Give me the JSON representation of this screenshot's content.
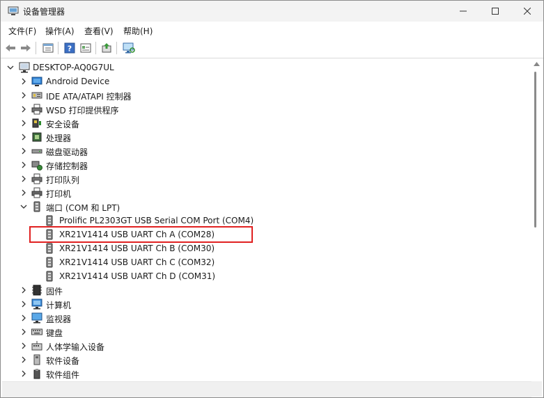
{
  "window": {
    "title": "设备管理器",
    "controls": [
      "minimize",
      "maximize",
      "close"
    ]
  },
  "menu": [
    "文件(F)",
    "操作(A)",
    "查看(V)",
    "帮助(H)"
  ],
  "toolbar": [
    "back-icon",
    "forward-icon",
    "properties-icon",
    "help-icon",
    "view-icon",
    "update-driver-icon",
    "monitor-scan-icon"
  ],
  "tree": {
    "root": "DESKTOP-AQ0G7UL",
    "categories": [
      {
        "label": "Android Device",
        "icon": "android-device-icon"
      },
      {
        "label": "IDE ATA/ATAPI 控制器",
        "icon": "ide-controller-icon"
      },
      {
        "label": "WSD 打印提供程序",
        "icon": "printer-provider-icon"
      },
      {
        "label": "安全设备",
        "icon": "security-device-icon"
      },
      {
        "label": "处理器",
        "icon": "processor-icon"
      },
      {
        "label": "磁盘驱动器",
        "icon": "disk-drive-icon"
      },
      {
        "label": "存储控制器",
        "icon": "storage-controller-icon"
      },
      {
        "label": "打印队列",
        "icon": "print-queue-icon"
      },
      {
        "label": "打印机",
        "icon": "printer-icon"
      },
      {
        "label": "端口 (COM 和 LPT)",
        "icon": "port-icon",
        "expanded": true
      },
      {
        "label": "固件",
        "icon": "firmware-icon"
      },
      {
        "label": "计算机",
        "icon": "computer-icon"
      },
      {
        "label": "监视器",
        "icon": "monitor-icon"
      },
      {
        "label": "键盘",
        "icon": "keyboard-icon"
      },
      {
        "label": "人体学输入设备",
        "icon": "hid-icon"
      },
      {
        "label": "软件设备",
        "icon": "software-device-icon"
      },
      {
        "label": "软件组件",
        "icon": "software-component-icon"
      }
    ],
    "ports": [
      "Prolific PL2303GT USB Serial COM Port (COM4)",
      "XR21V1414 USB UART Ch A (COM28)",
      "XR21V1414 USB UART Ch B (COM30)",
      "XR21V1414 USB UART Ch C (COM32)",
      "XR21V1414 USB UART Ch D (COM31)"
    ],
    "highlighted_port": "XR21V1414 USB UART Ch A (COM28)"
  },
  "colors": {
    "highlight": "#e02020",
    "titlebar": "#f3f3f3"
  }
}
